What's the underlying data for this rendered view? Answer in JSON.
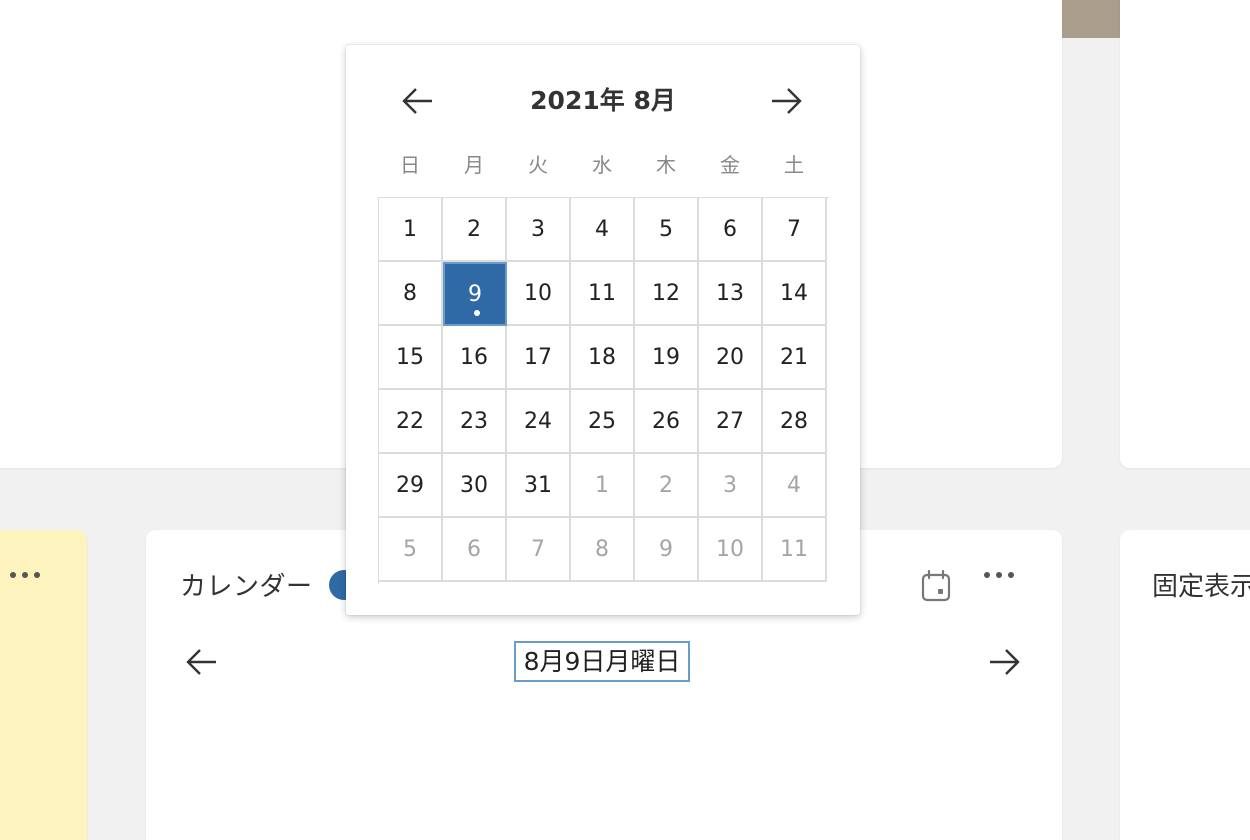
{
  "colors": {
    "accent": "#2f6aa6",
    "focus_outline": "#6a9cc9",
    "sticky_note": "#fdf3bf",
    "muted_text": "#a5a5a5"
  },
  "calendar_widget": {
    "title": "カレンダー",
    "current_date": "8月9日月曜日",
    "prev_icon": "arrow-left-icon",
    "next_icon": "arrow-right-icon",
    "calendar_icon": "calendar-icon",
    "more_icon": "more-horizontal-icon"
  },
  "pinned_widget": {
    "title": "固定表示"
  },
  "date_picker": {
    "month_title": "2021年 8月",
    "weekdays": [
      "日",
      "月",
      "火",
      "水",
      "木",
      "金",
      "土"
    ],
    "weeks": [
      [
        {
          "d": "1",
          "m": false
        },
        {
          "d": "2",
          "m": false
        },
        {
          "d": "3",
          "m": false
        },
        {
          "d": "4",
          "m": false
        },
        {
          "d": "5",
          "m": false
        },
        {
          "d": "6",
          "m": false
        },
        {
          "d": "7",
          "m": false
        }
      ],
      [
        {
          "d": "8",
          "m": false
        },
        {
          "d": "9",
          "m": false,
          "selected": true
        },
        {
          "d": "10",
          "m": false
        },
        {
          "d": "11",
          "m": false
        },
        {
          "d": "12",
          "m": false
        },
        {
          "d": "13",
          "m": false
        },
        {
          "d": "14",
          "m": false
        }
      ],
      [
        {
          "d": "15",
          "m": false
        },
        {
          "d": "16",
          "m": false
        },
        {
          "d": "17",
          "m": false
        },
        {
          "d": "18",
          "m": false
        },
        {
          "d": "19",
          "m": false
        },
        {
          "d": "20",
          "m": false
        },
        {
          "d": "21",
          "m": false
        }
      ],
      [
        {
          "d": "22",
          "m": false
        },
        {
          "d": "23",
          "m": false
        },
        {
          "d": "24",
          "m": false
        },
        {
          "d": "25",
          "m": false
        },
        {
          "d": "26",
          "m": false
        },
        {
          "d": "27",
          "m": false
        },
        {
          "d": "28",
          "m": false
        }
      ],
      [
        {
          "d": "29",
          "m": false
        },
        {
          "d": "30",
          "m": false
        },
        {
          "d": "31",
          "m": false
        },
        {
          "d": "1",
          "m": true
        },
        {
          "d": "2",
          "m": true
        },
        {
          "d": "3",
          "m": true
        },
        {
          "d": "4",
          "m": true
        }
      ],
      [
        {
          "d": "5",
          "m": true
        },
        {
          "d": "6",
          "m": true
        },
        {
          "d": "7",
          "m": true
        },
        {
          "d": "8",
          "m": true
        },
        {
          "d": "9",
          "m": true
        },
        {
          "d": "10",
          "m": true
        },
        {
          "d": "11",
          "m": true
        }
      ]
    ]
  }
}
